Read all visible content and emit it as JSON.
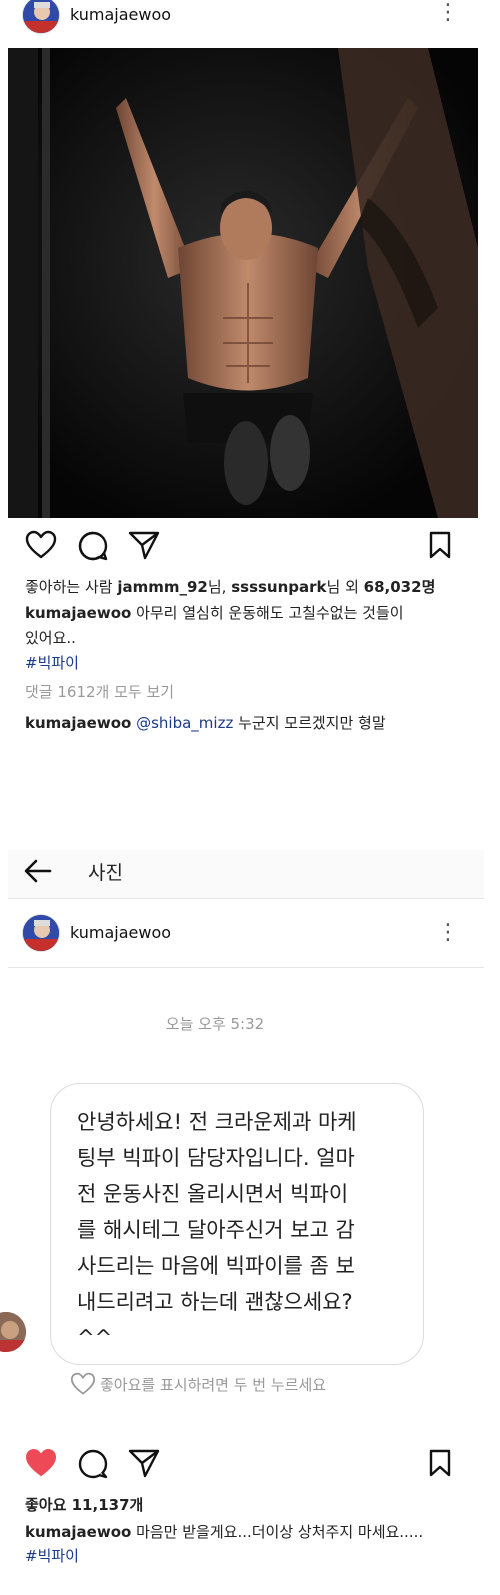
{
  "post1": {
    "username": "kumajaewoo",
    "likes_prefix": "좋아하는 사람 ",
    "liker1": "jammm_92",
    "liker1_suffix": "님, ",
    "liker2": "ssssunpark",
    "liker2_suffix": "님 외 ",
    "like_count": "68,032",
    "like_unit": "명",
    "caption_user": "kumajaewoo",
    "caption_line1": " 아무리 열심히 운동해도 고칠수없는 것들이",
    "caption_line2": "있어요..",
    "hashtag": "#빅파이",
    "view_comments": "댓글 1612개 모두 보기",
    "comment_user": "kumajaewoo",
    "comment_mention": "@shiba_mizz",
    "comment_text": " 누군지 모르겠지만 형말"
  },
  "dm": {
    "back_label": "사진",
    "username": "kumajaewoo",
    "timestamp": "오늘 오후 5:32",
    "message": "안녕하세요! 전 크라운제과 마케\n팅부 빅파이 담당자입니다. 얼마\n전 운동사진 올리시면서 빅파이\n를 해시테그 달아주신거 보고 감\n사드리는 마음에 빅파이를 좀 보\n내드리려고 하는데 괜찮으세요?\n^^",
    "like_hint": "좋아요를 표시하려면 두 번 누르세요"
  },
  "post2": {
    "likes_label": "좋아요 11,137개",
    "caption_user": "kumajaewoo",
    "caption_text": " 마음만 받을게요...더이상 상처주지 마세요.....",
    "hashtag": "#빅파이"
  },
  "colors": {
    "heart_red": "#ed4956",
    "link_blue": "#1b3a8a"
  },
  "icons": [
    "more-vert-icon",
    "heart-icon",
    "comment-icon",
    "share-icon",
    "bookmark-icon",
    "back-arrow-icon"
  ]
}
